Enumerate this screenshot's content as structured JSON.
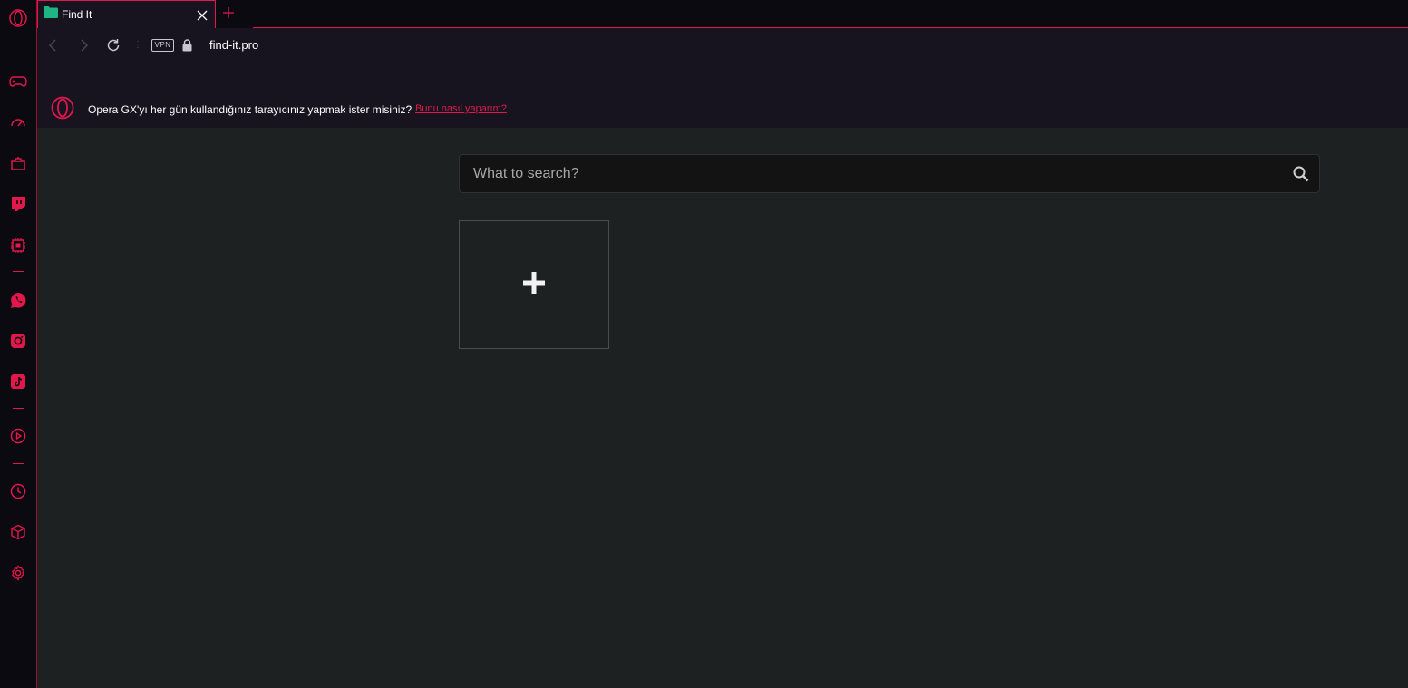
{
  "browser": {
    "name": "Opera GX",
    "accent": "#e2174b"
  },
  "sidebar": {
    "items": [
      {
        "name": "opera-logo-icon"
      },
      {
        "name": "gamepad-icon"
      },
      {
        "name": "gx-control-icon"
      },
      {
        "name": "gx-corner-icon"
      },
      {
        "name": "twitch-icon"
      },
      {
        "name": "hardware-chip-icon"
      },
      {
        "name": "whatsapp-icon"
      },
      {
        "name": "instagram-icon"
      },
      {
        "name": "tiktok-icon"
      },
      {
        "name": "player-icon"
      },
      {
        "name": "history-icon"
      },
      {
        "name": "extensions-icon"
      },
      {
        "name": "settings-icon"
      }
    ]
  },
  "tabs": [
    {
      "title": "Find It",
      "active": true,
      "favicon_color": "#1db584"
    }
  ],
  "address_bar": {
    "vpn_label": "VPN",
    "url": "find-it.pro"
  },
  "promo_bar": {
    "text": "Opera GX'yı her gün kullandığınız tarayıcınız yapmak ister misiniz?",
    "link": "Bunu nasıl yaparım?"
  },
  "page": {
    "search": {
      "placeholder": "What to search?",
      "value": ""
    },
    "add_tile_icon": "plus-icon"
  }
}
